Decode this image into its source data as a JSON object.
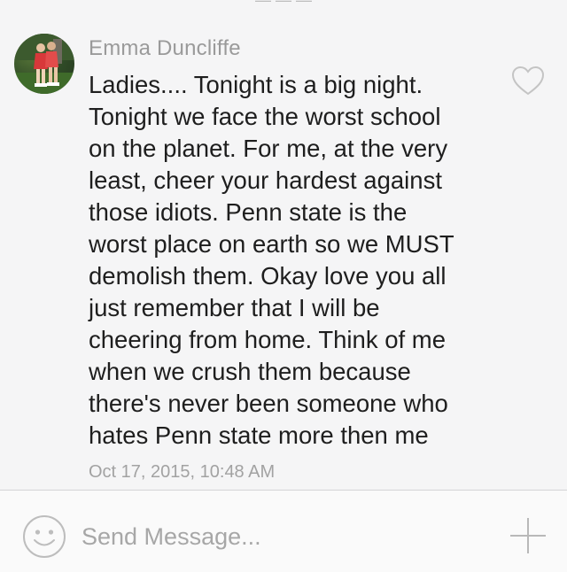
{
  "message": {
    "sender": "Emma Duncliffe",
    "text": "Ladies.... Tonight is a big night.\nTonight we face the worst school\non the planet. For me, at the very\nleast, cheer your hardest against\nthose idiots. Penn state is the\nworst place on earth so we MUST\ndemolish them. Okay love you all\njust remember that I will be\ncheering from home. Think of me\nwhen we crush them because\nthere's never been someone who\nhates Penn state more then me",
    "timestamp": "Oct 17, 2015, 10:48 AM",
    "like_icon": "heart-outline-icon"
  },
  "composer": {
    "placeholder": "Send Message...",
    "emoji_icon": "smiley-icon",
    "attach_icon": "plus-icon"
  },
  "colors": {
    "background": "#f5f5f6",
    "secondary_text": "#9a9a9a",
    "primary_text": "#1e1e1e",
    "icon_stroke": "#c4c4c4"
  }
}
